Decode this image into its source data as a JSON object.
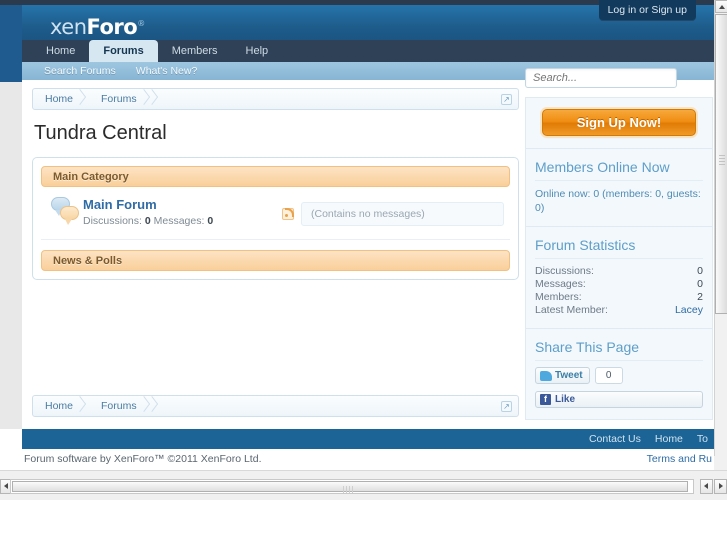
{
  "header": {
    "logo_text": "xen",
    "logo_bold": "Foro",
    "logo_tm": "®",
    "login_label": "Log in or Sign up"
  },
  "nav": {
    "tabs": [
      {
        "label": "Home",
        "selected": false
      },
      {
        "label": "Forums",
        "selected": true
      },
      {
        "label": "Members",
        "selected": false
      },
      {
        "label": "Help",
        "selected": false
      }
    ],
    "subnav": [
      {
        "label": "Search Forums"
      },
      {
        "label": "What's New?"
      }
    ]
  },
  "breadcrumb": {
    "items": [
      {
        "label": "Home"
      },
      {
        "label": "Forums"
      }
    ],
    "popup_icon": "↗"
  },
  "main": {
    "page_title": "Tundra Central",
    "categories": [
      {
        "title": "Main Category",
        "forums": [
          {
            "title": "Main Forum",
            "stats_prefix": "Discussions: ",
            "discussions": "0",
            "stats_mid": " Messages: ",
            "messages": "0",
            "last_post": "(Contains no messages)",
            "rss_icon": "rss-icon",
            "forum_icon": "speech-bubbles-icon"
          }
        ]
      },
      {
        "title": "News & Polls",
        "forums": []
      }
    ]
  },
  "sidebar": {
    "search_placeholder": "Search...",
    "signup_label": "Sign Up Now!",
    "members_online": {
      "heading": "Members Online Now",
      "text": "Online now: 0 (members: 0, guests: 0)"
    },
    "forum_statistics": {
      "heading": "Forum Statistics",
      "rows": [
        {
          "label": "Discussions:",
          "value": "0",
          "is_link": false
        },
        {
          "label": "Messages:",
          "value": "0",
          "is_link": false
        },
        {
          "label": "Members:",
          "value": "2",
          "is_link": false
        },
        {
          "label": "Latest Member:",
          "value": "Lacey",
          "is_link": true
        }
      ]
    },
    "share": {
      "heading": "Share This Page",
      "tweet_label": "Tweet",
      "tweet_count": "0",
      "like_label": "Like",
      "facebook_glyph": "f"
    }
  },
  "footer": {
    "links": [
      {
        "label": "Contact Us"
      },
      {
        "label": "Home"
      },
      {
        "label": "To"
      }
    ],
    "copyright": "Forum software by XenForo™ ©2011 XenForo Ltd.",
    "terms": "Terms and Ru"
  },
  "colors": {
    "header_blue": "#1e5c8b",
    "navbar_dark": "#2f4156",
    "subnav_blue": "#87b5d4",
    "category_orange": "#f9cf9a",
    "signup_orange": "#ef8c10",
    "link_blue": "#2f6ca5",
    "footer_blue": "#1d6496"
  }
}
